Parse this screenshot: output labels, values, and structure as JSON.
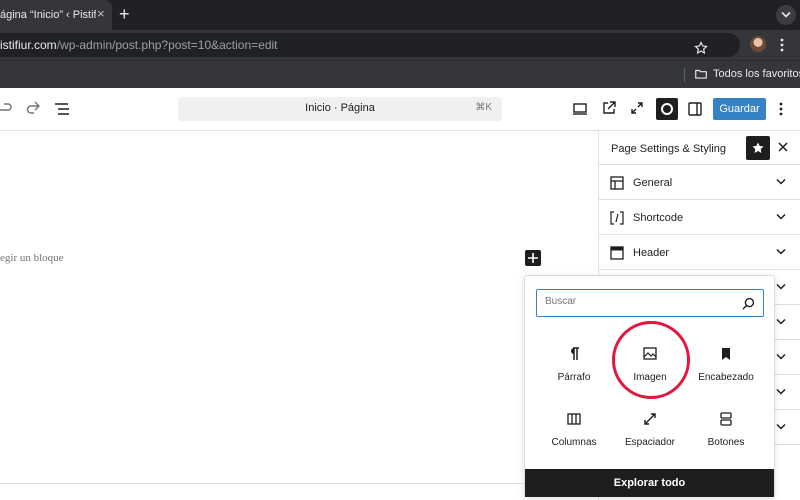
{
  "browser": {
    "tab_title": "ágina “Inicio” ‹ Pistifiur",
    "tab_close": "×",
    "new_tab": "+",
    "url_host": "istifiur.com",
    "url_path": "/wp-admin/post.php?post=10&action=edit",
    "bookmarks_folder": "Todos los favoritos"
  },
  "editor": {
    "command_bar_title": "Inicio · Página",
    "command_bar_shortcut": "⌘K",
    "save_label": "Guardar",
    "placeholder": "egir un bloque"
  },
  "sidebar": {
    "title": "Page Settings & Styling",
    "panels": [
      {
        "label": "General",
        "icon": "layout-icon"
      },
      {
        "label": "Shortcode",
        "icon": "shortcode-icon"
      },
      {
        "label": "Header",
        "icon": "header-icon"
      },
      {
        "label": "",
        "icon": ""
      },
      {
        "label": "",
        "icon": ""
      },
      {
        "label": "",
        "icon": ""
      },
      {
        "label": "",
        "icon": ""
      },
      {
        "label": "",
        "icon": ""
      }
    ]
  },
  "inserter": {
    "search_placeholder": "Buscar",
    "blocks": [
      {
        "label": "Párrafo",
        "icon": "paragraph-icon"
      },
      {
        "label": "Imagen",
        "icon": "image-icon"
      },
      {
        "label": "Encabezado",
        "icon": "bookmark-icon"
      },
      {
        "label": "Columnas",
        "icon": "columns-icon"
      },
      {
        "label": "Espaciador",
        "icon": "resize-icon"
      },
      {
        "label": "Botones",
        "icon": "buttons-icon"
      }
    ],
    "explore_label": "Explorar todo",
    "highlighted_block": "Imagen"
  },
  "colors": {
    "accent": "#3582c4",
    "highlight": "#e4163e",
    "dark": "#1e1e1e"
  }
}
